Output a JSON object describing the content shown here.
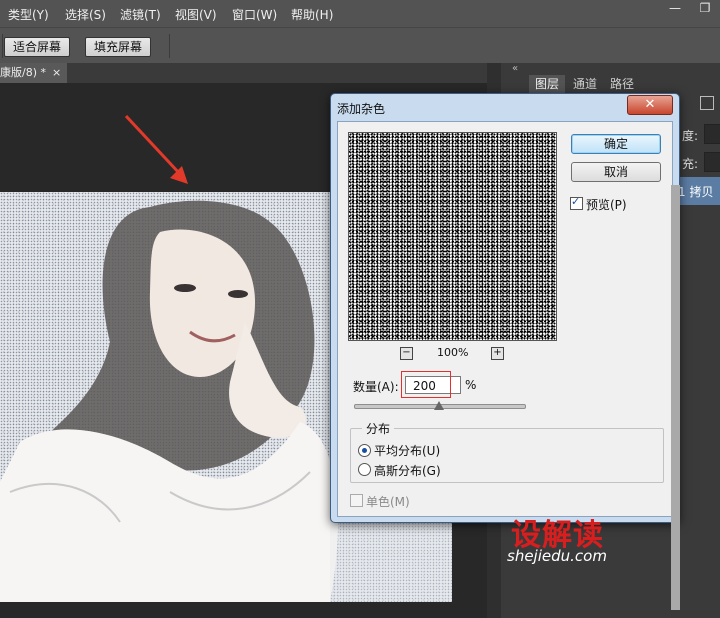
{
  "menubar": {
    "items": [
      "类型(Y)",
      "选择(S)",
      "滤镜(T)",
      "视图(V)",
      "窗口(W)",
      "帮助(H)"
    ],
    "minimize": "—",
    "restore": "❐"
  },
  "options": {
    "fit_screen": "适合屏幕",
    "fill_screen": "填充屏幕"
  },
  "document": {
    "tab_label": "康版/8) *",
    "tab_close": "×"
  },
  "panel": {
    "collapse": "«",
    "tabs": [
      "图层",
      "通道",
      "路径"
    ],
    "opacity_label": "度:",
    "fill_label": "充:",
    "layer_name": "1 拷贝"
  },
  "dialog": {
    "title": "添加杂色",
    "close": "✕",
    "ok": "确定",
    "cancel": "取消",
    "preview_label": "预览(P)",
    "preview_checked": true,
    "zoom_out": "−",
    "zoom_in": "+",
    "zoom": "100%",
    "amount_label": "数量(A):",
    "amount_value": "200",
    "amount_unit": "%",
    "slider_fraction": 0.5,
    "distribution_title": "分布",
    "uniform_label": "平均分布(U)",
    "gaussian_label": "高斯分布(G)",
    "selected_distribution": "uniform",
    "mono_label": "单色(M)",
    "mono_checked": false
  },
  "watermark": {
    "logo": "设解读",
    "url": "shejiedu.com"
  },
  "colors": {
    "arrow": "#e23a2a",
    "highlight_box": "#e03030",
    "brand": "#d81e1e"
  }
}
